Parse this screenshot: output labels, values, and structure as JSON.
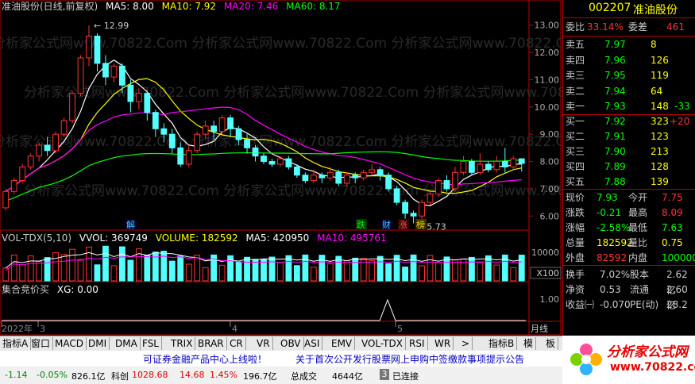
{
  "header": {
    "title": "准油股份(日线,前复权)",
    "ma5": "MA5: 8.00",
    "ma10": "MA10: 7.92",
    "ma20": "MA20: 7.46",
    "ma60": "MA60: 8.17"
  },
  "price_axis": [
    "13.00",
    "12.00",
    "11.00",
    "10.00",
    "9.00",
    "8.00",
    "7.00",
    "6.00"
  ],
  "annotations": {
    "high": "12.99",
    "low": "5.73",
    "m1": "解",
    "m2": "跌",
    "m3": "财",
    "m4": "涨",
    "m5": "榜"
  },
  "vol_header": {
    "name": "VOL-TDX(5,10)",
    "vvol": "VVOL: 369749",
    "volume": "VOLUME: 182592",
    "ma5": "MA5: 420950",
    "ma10": "MA10: 495761"
  },
  "vol_axis": [
    "10000",
    "X100"
  ],
  "xg_header": {
    "name": "集合竞价买",
    "xg": "XG: 0.00"
  },
  "xg_axis": [
    "1.00"
  ],
  "date_axis": [
    "2022年",
    "3",
    "4",
    "5"
  ],
  "axis_corner": "月线",
  "watermark": "分析家公式网www.70822.Com",
  "stock": {
    "code": "002207",
    "name": "准油股份"
  },
  "weibi": {
    "label1": "委比",
    "value1": "33.14%",
    "label2": "委差",
    "value2": "461"
  },
  "sell": [
    {
      "label": "卖五",
      "price": "7.97",
      "vol": "8",
      "diff": ""
    },
    {
      "label": "卖四",
      "price": "7.96",
      "vol": "126",
      "diff": ""
    },
    {
      "label": "卖三",
      "price": "7.95",
      "vol": "119",
      "diff": ""
    },
    {
      "label": "卖二",
      "price": "7.94",
      "vol": "64",
      "diff": ""
    },
    {
      "label": "卖一",
      "price": "7.93",
      "vol": "148",
      "diff": "-33"
    }
  ],
  "buy": [
    {
      "label": "买一",
      "price": "7.92",
      "vol": "323",
      "diff": "+20"
    },
    {
      "label": "买二",
      "price": "7.91",
      "vol": "123",
      "diff": ""
    },
    {
      "label": "买三",
      "price": "7.90",
      "vol": "213",
      "diff": ""
    },
    {
      "label": "买四",
      "price": "7.89",
      "vol": "128",
      "diff": ""
    },
    {
      "label": "买五",
      "price": "7.88",
      "vol": "139",
      "diff": ""
    }
  ],
  "quote": [
    {
      "l1": "现价",
      "v1": "7.93",
      "l2": "今开",
      "v2": "7.75"
    },
    {
      "l1": "涨跌",
      "v1": "-0.21",
      "l2": "最高",
      "v2": "8.09"
    },
    {
      "l1": "涨幅",
      "v1": "-2.58%",
      "l2": "最低",
      "v2": "7.63"
    },
    {
      "l1": "总量",
      "v1": "182592",
      "l2": "量比",
      "v2": "0.75"
    },
    {
      "l1": "外盘",
      "v1": "82592",
      "l2": "内盘",
      "v2": "100000"
    }
  ],
  "quote2": [
    {
      "l1": "换手",
      "v1": "7.02%",
      "l2": "股本",
      "v2": "2.62亿"
    },
    {
      "l1": "净资",
      "v1": "0.53",
      "l2": "流通",
      "v2": "2.60亿"
    },
    {
      "l1": "收益㈠",
      "v1": "-0.070",
      "l2": "PE(动)",
      "v2": "28.2"
    }
  ],
  "tabs": [
    "指标A",
    "窗口",
    "MACD",
    "DMI",
    "DMA",
    "FSL",
    "TRIX",
    "BRAR",
    "CR",
    "VR",
    "OBV",
    "ASI",
    "EMV",
    "VOL-TDX",
    "RSI",
    "WR",
    ">",
    "指标B",
    "模",
    "板"
  ],
  "news": {
    "left": "可证券金融产品中心上线啦！",
    "right": "关于首次公开发行股票网上申购中签缴款事项提示公告"
  },
  "status": {
    "a": "-1.14",
    "b": "-0.05%",
    "c": "826.1亿",
    "d": "科创",
    "e": "1028.68",
    "f": "14.68",
    "g": "1.45%",
    "h": "196.7亿",
    "i": "总成交",
    "j": "4644亿",
    "k": "3",
    "l": "已连接"
  },
  "logo": {
    "text": "分析家公式网",
    "url": "www.70822.com"
  },
  "colors": {
    "up": "#ff3232",
    "down": "#54ffff",
    "ma5": "#ffffff",
    "ma10": "#ffff00",
    "ma20": "#ff00ff",
    "ma60": "#00ff00",
    "border": "#b00000"
  },
  "chart_data": {
    "type": "candlestick",
    "ylim": [
      5.6,
      13.4
    ],
    "candles": [
      [
        6.3,
        6.9,
        6.2,
        7.0
      ],
      [
        6.9,
        7.3,
        6.8,
        7.4
      ],
      [
        7.3,
        7.8,
        7.2,
        7.9
      ],
      [
        7.8,
        8.2,
        7.7,
        8.3
      ],
      [
        8.2,
        8.6,
        8.0,
        8.7
      ],
      [
        8.6,
        8.4,
        8.2,
        8.9
      ],
      [
        8.4,
        9.0,
        8.3,
        9.1
      ],
      [
        9.0,
        9.5,
        8.9,
        9.6
      ],
      [
        9.5,
        10.5,
        9.4,
        10.6
      ],
      [
        10.5,
        11.8,
        10.4,
        11.9
      ],
      [
        11.8,
        12.6,
        11.5,
        12.99
      ],
      [
        12.6,
        11.6,
        11.3,
        12.7
      ],
      [
        11.6,
        11.1,
        10.8,
        11.9
      ],
      [
        11.1,
        11.5,
        10.9,
        11.6
      ],
      [
        11.5,
        10.8,
        10.5,
        11.6
      ],
      [
        10.8,
        10.2,
        9.8,
        11.0
      ],
      [
        10.2,
        10.5,
        9.9,
        10.7
      ],
      [
        10.5,
        9.8,
        9.5,
        10.6
      ],
      [
        9.8,
        9.2,
        8.9,
        9.9
      ],
      [
        9.2,
        9.0,
        8.7,
        9.4
      ],
      [
        9.0,
        8.5,
        8.3,
        9.2
      ],
      [
        8.5,
        7.9,
        7.8,
        8.7
      ],
      [
        7.9,
        8.4,
        7.8,
        8.6
      ],
      [
        8.4,
        9.0,
        8.3,
        9.1
      ],
      [
        9.0,
        9.3,
        8.8,
        9.5
      ],
      [
        9.3,
        9.1,
        8.8,
        9.5
      ],
      [
        9.1,
        9.6,
        9.0,
        9.7
      ],
      [
        9.6,
        9.2,
        8.9,
        9.7
      ],
      [
        9.2,
        8.8,
        8.6,
        9.3
      ],
      [
        8.8,
        8.5,
        8.3,
        9.0
      ],
      [
        8.5,
        8.2,
        8.0,
        8.6
      ],
      [
        8.2,
        8.0,
        7.9,
        8.3
      ],
      [
        8.0,
        7.9,
        7.8,
        8.1
      ],
      [
        7.9,
        8.1,
        7.8,
        8.2
      ],
      [
        8.1,
        7.8,
        7.7,
        8.2
      ],
      [
        7.8,
        7.5,
        7.4,
        7.9
      ],
      [
        7.5,
        7.3,
        7.2,
        7.6
      ],
      [
        7.3,
        7.5,
        7.2,
        7.7
      ],
      [
        7.5,
        7.4,
        7.2,
        7.6
      ],
      [
        7.4,
        7.6,
        7.3,
        7.8
      ],
      [
        7.6,
        7.2,
        7.1,
        7.7
      ],
      [
        7.2,
        7.5,
        7.1,
        7.6
      ],
      [
        7.5,
        7.4,
        7.2,
        7.6
      ],
      [
        7.4,
        7.6,
        7.3,
        7.7
      ],
      [
        7.6,
        7.7,
        7.5,
        7.9
      ],
      [
        7.7,
        7.5,
        7.3,
        7.8
      ],
      [
        7.5,
        7.0,
        6.9,
        7.6
      ],
      [
        7.0,
        6.5,
        6.4,
        7.1
      ],
      [
        6.5,
        6.1,
        5.9,
        6.6
      ],
      [
        6.1,
        6.0,
        5.73,
        6.2
      ],
      [
        6.0,
        6.5,
        5.9,
        6.6
      ],
      [
        6.5,
        6.8,
        6.4,
        6.9
      ],
      [
        6.8,
        7.3,
        6.7,
        7.4
      ],
      [
        7.3,
        7.0,
        6.9,
        7.5
      ],
      [
        7.0,
        7.6,
        6.9,
        7.8
      ],
      [
        7.6,
        8.0,
        7.5,
        8.2
      ],
      [
        8.0,
        7.6,
        7.5,
        8.1
      ],
      [
        7.6,
        7.9,
        7.5,
        8.3
      ],
      [
        7.9,
        7.7,
        7.6,
        8.0
      ],
      [
        7.7,
        8.0,
        7.6,
        8.2
      ],
      [
        8.0,
        7.8,
        7.6,
        8.5
      ],
      [
        7.8,
        8.1,
        7.7,
        8.2
      ],
      [
        8.1,
        7.93,
        7.63,
        8.09
      ]
    ],
    "volume_scale": "X100",
    "ma_values": {
      "MA5": 8.0,
      "MA10": 7.92,
      "MA20": 7.46,
      "MA60": 8.17
    }
  }
}
